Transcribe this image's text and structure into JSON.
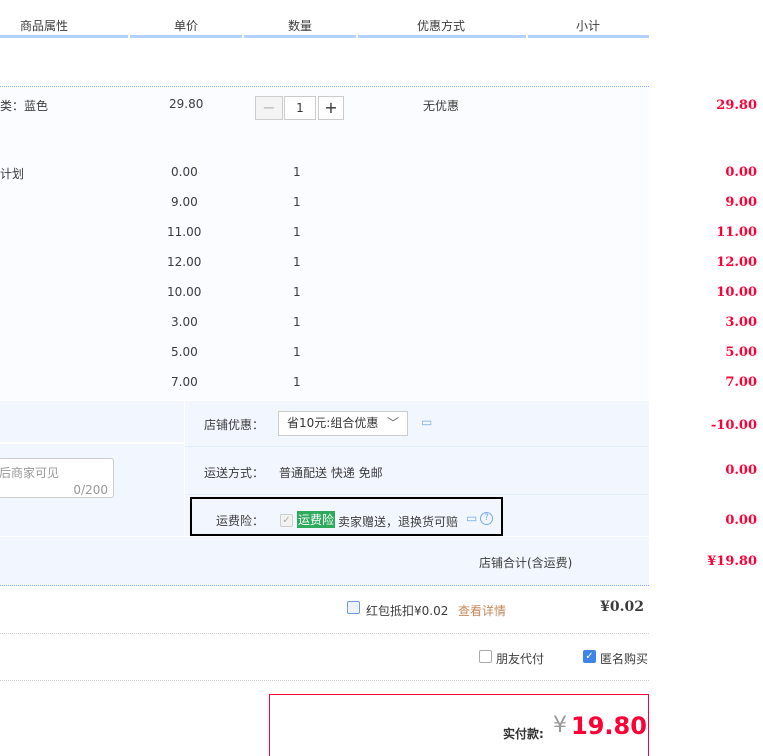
{
  "header": {
    "columns": [
      "商品属性",
      "单价",
      "数量",
      "优惠方式",
      "小计"
    ]
  },
  "main_item": {
    "attr": "类：蓝色",
    "price": "29.80",
    "qty": "1",
    "qty_minus": "−",
    "qty_plus": "+",
    "discount": "无优惠",
    "subtotal": "29.80"
  },
  "plan_label": "计划",
  "items": [
    {
      "price": "0.00",
      "qty": "1",
      "subtotal": "0.00"
    },
    {
      "price": "9.00",
      "qty": "1",
      "subtotal": "9.00"
    },
    {
      "price": "11.00",
      "qty": "1",
      "subtotal": "11.00"
    },
    {
      "price": "12.00",
      "qty": "1",
      "subtotal": "12.00"
    },
    {
      "price": "10.00",
      "qty": "1",
      "subtotal": "10.00"
    },
    {
      "price": "3.00",
      "qty": "1",
      "subtotal": "3.00"
    },
    {
      "price": "5.00",
      "qty": "1",
      "subtotal": "5.00"
    },
    {
      "price": "7.00",
      "qty": "1",
      "subtotal": "7.00"
    }
  ],
  "shop": {
    "discount_label": "店铺优惠：",
    "discount_select": "省10元:组合优惠",
    "discount_amount": "-10.00",
    "shipping_label": "运送方式：",
    "shipping_value": "普通配送 快递 免邮",
    "shipping_amount": "0.00",
    "insurance_label": "运费险：",
    "insurance_tag": "运费险",
    "insurance_text": "卖家赠送，退换货可赔",
    "insurance_amount": "0.00",
    "message_placeholder": "后商家可见",
    "message_counter": "0/200",
    "total_label": "店铺合计(含运费)",
    "total_value": "¥19.80"
  },
  "redpacket": {
    "label": "红包抵扣¥0.02",
    "link": "查看详情",
    "amount": "¥0.02"
  },
  "options": {
    "friend_pay": "朋友代付",
    "anonymous": "匿名购买"
  },
  "payment": {
    "label": "实付款:",
    "currency": "¥",
    "amount": "19.80"
  },
  "colors": {
    "price_red": "#ff0036",
    "header_blue": "#b2d1ff",
    "panel_bg": "#f2f7ff",
    "link_orange": "#c4885b",
    "tag_green": "#2eaa5d"
  }
}
